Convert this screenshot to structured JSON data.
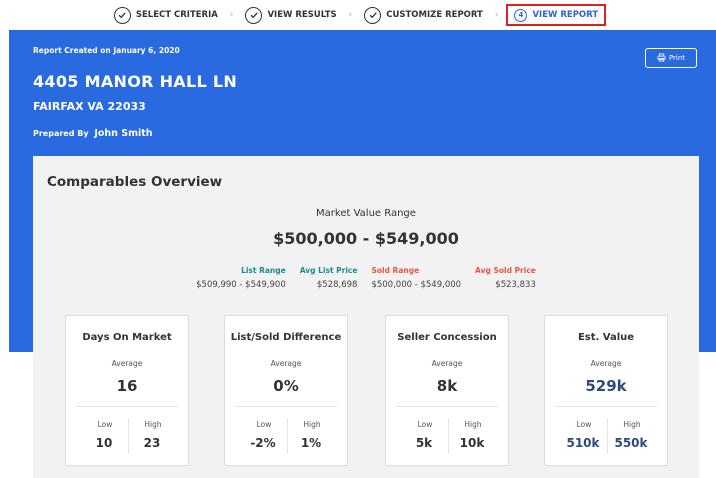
{
  "stepper": {
    "steps": [
      {
        "label": "SELECT CRITERIA",
        "state": "done"
      },
      {
        "label": "VIEW RESULTS",
        "state": "done"
      },
      {
        "label": "CUSTOMIZE REPORT",
        "state": "done"
      },
      {
        "label": "VIEW REPORT",
        "state": "active",
        "number": "4"
      }
    ]
  },
  "report": {
    "created": "Report Created on January 6, 2020",
    "address_line1": "4405 MANOR HALL LN",
    "address_line2": "FAIRFAX VA 22033",
    "prepared_by_label": "Prepared By",
    "prepared_by_name": "John Smith",
    "print_label": "Print"
  },
  "overview": {
    "title": "Comparables Overview",
    "market_value_label": "Market Value Range",
    "market_value": "$500,000 - $549,000",
    "ranges": [
      {
        "label": "List Range",
        "value": "$509,990 - $549,900",
        "color": "#1a8c8c"
      },
      {
        "label": "Avg List Price",
        "value": "$528,698",
        "color": "#1a8c8c"
      },
      {
        "label": "Sold Range",
        "value": "$500,000 - $549,000",
        "color": "#e5564a"
      },
      {
        "label": "Avg Sold Price",
        "value": "$523,833",
        "color": "#e5564a"
      }
    ],
    "cards": [
      {
        "title": "Days On Market",
        "avg_label": "Average",
        "avg": "16",
        "low_label": "Low",
        "low": "10",
        "high_label": "High",
        "high": "23"
      },
      {
        "title": "List/Sold Difference",
        "avg_label": "Average",
        "avg": "0%",
        "low_label": "Low",
        "low": "-2%",
        "high_label": "High",
        "high": "1%"
      },
      {
        "title": "Seller Concession",
        "avg_label": "Average",
        "avg": "8k",
        "low_label": "Low",
        "low": "5k",
        "high_label": "High",
        "high": "10k"
      },
      {
        "title": "Est. Value",
        "avg_label": "Average",
        "avg": "529k",
        "low_label": "Low",
        "low": "510k",
        "high_label": "High",
        "high": "550k"
      }
    ]
  },
  "colors": {
    "accent": "#2a6ae0",
    "active_step": "#2a63d6",
    "active_border": "#e02020"
  }
}
